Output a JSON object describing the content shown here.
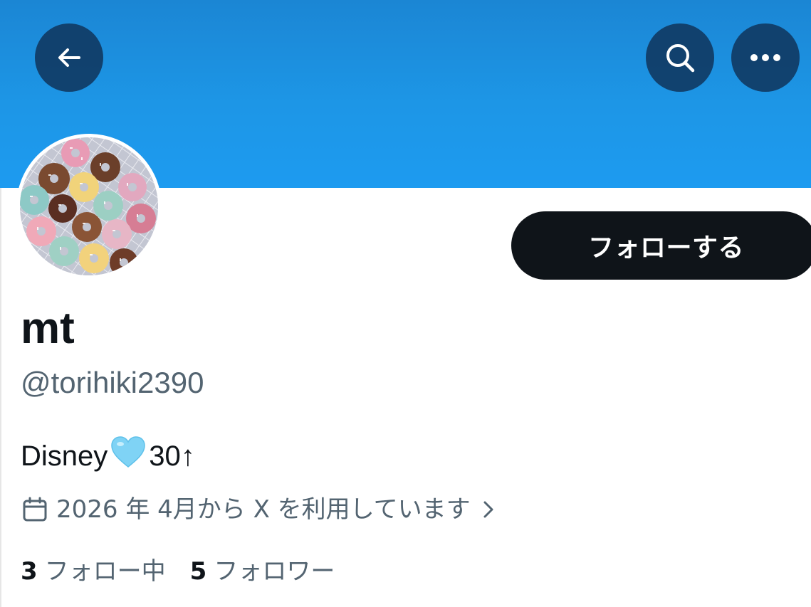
{
  "header": {
    "back_icon": "arrow-left-icon",
    "search_icon": "search-icon",
    "more_icon": "more-horizontal-icon",
    "banner_color": "#1d9bf0"
  },
  "profile": {
    "display_name": "mt",
    "handle": "@torihiki2390",
    "bio_text": "Disney",
    "bio_emoji": "light-blue-heart",
    "bio_suffix": "30↑",
    "joined": "2026 年 4月から X を利用しています",
    "follow_label": "フォローする"
  },
  "stats": {
    "following_count": "3",
    "following_label": "フォロー中",
    "followers_count": "5",
    "followers_label": "フォロワー"
  }
}
